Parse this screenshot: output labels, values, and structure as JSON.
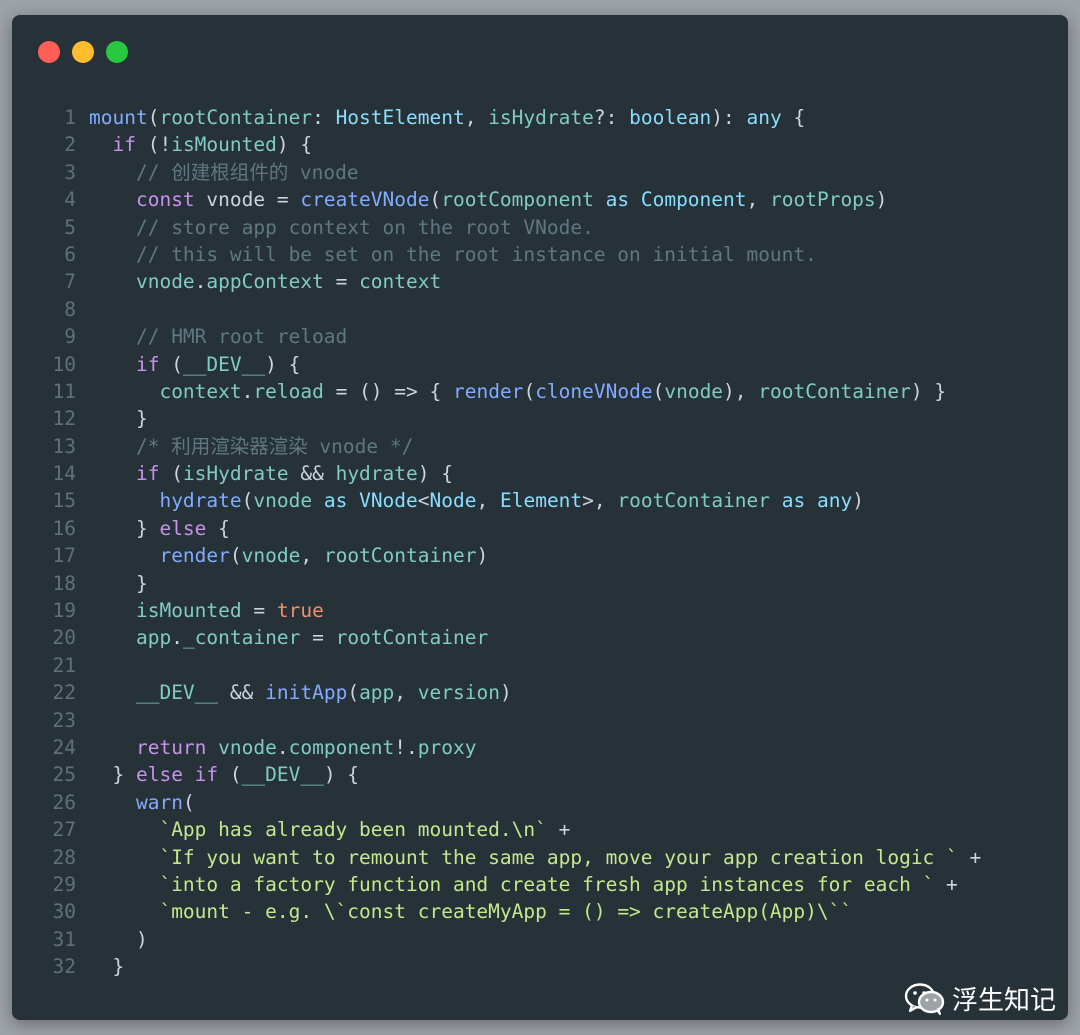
{
  "window": {
    "controls": [
      "close",
      "minimize",
      "maximize"
    ]
  },
  "colors": {
    "background": "#263238",
    "function": "#82aaff",
    "keyword": "#c792ea",
    "type": "#89ddff",
    "variable": "#80cbc4",
    "comment": "#5f7780",
    "string": "#c3e88d",
    "boolean": "#f78c6c",
    "punctuation": "#cdd3de"
  },
  "code": {
    "language": "typescript",
    "lines": [
      {
        "n": 1,
        "indent": 0,
        "tokens": [
          [
            "fn",
            "mount"
          ],
          [
            "p",
            "("
          ],
          [
            "var",
            "rootContainer"
          ],
          [
            "p",
            ": "
          ],
          [
            "ty",
            "HostElement"
          ],
          [
            "p",
            ", "
          ],
          [
            "var",
            "isHydrate"
          ],
          [
            "p",
            "?: "
          ],
          [
            "ty",
            "boolean"
          ],
          [
            "p",
            "): "
          ],
          [
            "ty",
            "any"
          ],
          [
            "p",
            " {"
          ]
        ]
      },
      {
        "n": 2,
        "indent": 1,
        "tokens": [
          [
            "kw",
            "if"
          ],
          [
            "p",
            " (!"
          ],
          [
            "var",
            "isMounted"
          ],
          [
            "p",
            ") {"
          ]
        ]
      },
      {
        "n": 3,
        "indent": 2,
        "tokens": [
          [
            "cm",
            "// 创建根组件的 vnode"
          ]
        ]
      },
      {
        "n": 4,
        "indent": 2,
        "tokens": [
          [
            "kw",
            "const"
          ],
          [
            "p",
            " vnode = "
          ],
          [
            "fn",
            "createVNode"
          ],
          [
            "p",
            "("
          ],
          [
            "var",
            "rootComponent"
          ],
          [
            "p",
            " "
          ],
          [
            "ty",
            "as"
          ],
          [
            "p",
            " "
          ],
          [
            "ty",
            "Component"
          ],
          [
            "p",
            ", "
          ],
          [
            "var",
            "rootProps"
          ],
          [
            "p",
            ")"
          ]
        ]
      },
      {
        "n": 5,
        "indent": 2,
        "tokens": [
          [
            "cm",
            "// store app context on the root VNode."
          ]
        ]
      },
      {
        "n": 6,
        "indent": 2,
        "tokens": [
          [
            "cm",
            "// this will be set on the root instance on initial mount."
          ]
        ]
      },
      {
        "n": 7,
        "indent": 2,
        "tokens": [
          [
            "var",
            "vnode"
          ],
          [
            "p",
            "."
          ],
          [
            "var",
            "appContext"
          ],
          [
            "p",
            " = "
          ],
          [
            "var",
            "context"
          ]
        ]
      },
      {
        "n": 8,
        "indent": 0,
        "tokens": []
      },
      {
        "n": 9,
        "indent": 2,
        "tokens": [
          [
            "cm",
            "// HMR root reload"
          ]
        ]
      },
      {
        "n": 10,
        "indent": 2,
        "tokens": [
          [
            "kw",
            "if"
          ],
          [
            "p",
            " ("
          ],
          [
            "var",
            "__DEV__"
          ],
          [
            "p",
            ") {"
          ]
        ]
      },
      {
        "n": 11,
        "indent": 3,
        "tokens": [
          [
            "var",
            "context"
          ],
          [
            "p",
            "."
          ],
          [
            "var",
            "reload"
          ],
          [
            "p",
            " = () => { "
          ],
          [
            "fn",
            "render"
          ],
          [
            "p",
            "("
          ],
          [
            "fn",
            "cloneVNode"
          ],
          [
            "p",
            "("
          ],
          [
            "var",
            "vnode"
          ],
          [
            "p",
            "), "
          ],
          [
            "var",
            "rootContainer"
          ],
          [
            "p",
            ") }"
          ]
        ]
      },
      {
        "n": 12,
        "indent": 2,
        "tokens": [
          [
            "p",
            "}"
          ]
        ]
      },
      {
        "n": 13,
        "indent": 2,
        "tokens": [
          [
            "cm",
            "/* 利用渲染器渲染 vnode */"
          ]
        ]
      },
      {
        "n": 14,
        "indent": 2,
        "tokens": [
          [
            "kw",
            "if"
          ],
          [
            "p",
            " ("
          ],
          [
            "var",
            "isHydrate"
          ],
          [
            "p",
            " && "
          ],
          [
            "var",
            "hydrate"
          ],
          [
            "p",
            ") {"
          ]
        ]
      },
      {
        "n": 15,
        "indent": 3,
        "tokens": [
          [
            "fn",
            "hydrate"
          ],
          [
            "p",
            "("
          ],
          [
            "var",
            "vnode"
          ],
          [
            "p",
            " "
          ],
          [
            "ty",
            "as"
          ],
          [
            "p",
            " "
          ],
          [
            "ty",
            "VNode"
          ],
          [
            "p",
            "<"
          ],
          [
            "ty",
            "Node"
          ],
          [
            "p",
            ", "
          ],
          [
            "ty",
            "Element"
          ],
          [
            "p",
            ">, "
          ],
          [
            "var",
            "rootContainer"
          ],
          [
            "p",
            " "
          ],
          [
            "ty",
            "as"
          ],
          [
            "p",
            " "
          ],
          [
            "ty",
            "any"
          ],
          [
            "p",
            ")"
          ]
        ]
      },
      {
        "n": 16,
        "indent": 2,
        "tokens": [
          [
            "p",
            "} "
          ],
          [
            "kw",
            "else"
          ],
          [
            "p",
            " {"
          ]
        ]
      },
      {
        "n": 17,
        "indent": 3,
        "tokens": [
          [
            "fn",
            "render"
          ],
          [
            "p",
            "("
          ],
          [
            "var",
            "vnode"
          ],
          [
            "p",
            ", "
          ],
          [
            "var",
            "rootContainer"
          ],
          [
            "p",
            ")"
          ]
        ]
      },
      {
        "n": 18,
        "indent": 2,
        "tokens": [
          [
            "p",
            "}"
          ]
        ]
      },
      {
        "n": 19,
        "indent": 2,
        "tokens": [
          [
            "var",
            "isMounted"
          ],
          [
            "p",
            " = "
          ],
          [
            "bool",
            "true"
          ]
        ]
      },
      {
        "n": 20,
        "indent": 2,
        "tokens": [
          [
            "var",
            "app"
          ],
          [
            "p",
            "."
          ],
          [
            "var",
            "_container"
          ],
          [
            "p",
            " = "
          ],
          [
            "var",
            "rootContainer"
          ]
        ]
      },
      {
        "n": 21,
        "indent": 0,
        "tokens": []
      },
      {
        "n": 22,
        "indent": 2,
        "tokens": [
          [
            "var",
            "__DEV__"
          ],
          [
            "p",
            " && "
          ],
          [
            "fn",
            "initApp"
          ],
          [
            "p",
            "("
          ],
          [
            "var",
            "app"
          ],
          [
            "p",
            ", "
          ],
          [
            "var",
            "version"
          ],
          [
            "p",
            ")"
          ]
        ]
      },
      {
        "n": 23,
        "indent": 0,
        "tokens": []
      },
      {
        "n": 24,
        "indent": 2,
        "tokens": [
          [
            "kw",
            "return"
          ],
          [
            "p",
            " "
          ],
          [
            "var",
            "vnode"
          ],
          [
            "p",
            "."
          ],
          [
            "var",
            "component"
          ],
          [
            "p",
            "!."
          ],
          [
            "var",
            "proxy"
          ]
        ]
      },
      {
        "n": 25,
        "indent": 1,
        "tokens": [
          [
            "p",
            "} "
          ],
          [
            "kw",
            "else if"
          ],
          [
            "p",
            " ("
          ],
          [
            "var",
            "__DEV__"
          ],
          [
            "p",
            ") {"
          ]
        ]
      },
      {
        "n": 26,
        "indent": 2,
        "tokens": [
          [
            "fn",
            "warn"
          ],
          [
            "p",
            "("
          ]
        ]
      },
      {
        "n": 27,
        "indent": 3,
        "tokens": [
          [
            "str",
            "`App has already been mounted.\\n`"
          ],
          [
            "p",
            " +"
          ]
        ]
      },
      {
        "n": 28,
        "indent": 3,
        "tokens": [
          [
            "str",
            "`If you want to remount the same app, move your app creation logic `"
          ],
          [
            "p",
            " +"
          ]
        ]
      },
      {
        "n": 29,
        "indent": 3,
        "tokens": [
          [
            "str",
            "`into a factory function and create fresh app instances for each `"
          ],
          [
            "p",
            " +"
          ]
        ]
      },
      {
        "n": 30,
        "indent": 3,
        "tokens": [
          [
            "str",
            "`mount - e.g. \\`const createMyApp = () => createApp(App)\\``"
          ]
        ]
      },
      {
        "n": 31,
        "indent": 2,
        "tokens": [
          [
            "p",
            ")"
          ]
        ]
      },
      {
        "n": 32,
        "indent": 1,
        "tokens": [
          [
            "p",
            "}"
          ]
        ]
      }
    ]
  },
  "watermark": {
    "icon": "wechat-icon",
    "text": "浮生知记"
  }
}
